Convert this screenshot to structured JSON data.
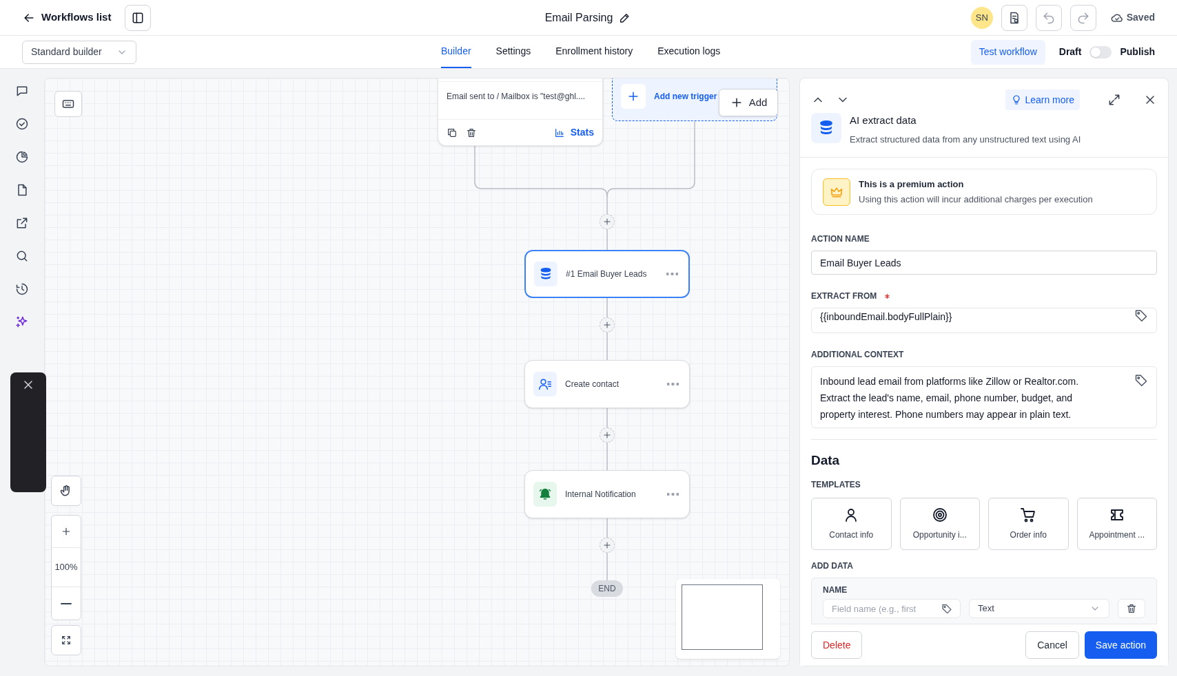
{
  "header": {
    "back_label": "Workflows list",
    "title": "Email Parsing",
    "avatar": "SN",
    "save_status": "Saved"
  },
  "toolbar": {
    "builder_select": "Standard builder",
    "tabs": [
      {
        "label": "Builder",
        "selected": true
      },
      {
        "label": "Settings",
        "selected": false
      },
      {
        "label": "Enrollment history",
        "selected": false
      },
      {
        "label": "Execution logs",
        "selected": false
      }
    ],
    "test_button": "Test workflow",
    "draft_label": "Draft",
    "publish_on": false,
    "publish_label": "Publish"
  },
  "rail": {
    "items": [
      {
        "kind": "chat",
        "selected": false
      },
      {
        "kind": "check",
        "selected": false
      },
      {
        "kind": "pie",
        "selected": false
      },
      {
        "kind": "file",
        "selected": false
      },
      {
        "kind": "external",
        "selected": false
      },
      {
        "kind": "search",
        "selected": false
      },
      {
        "kind": "history",
        "selected": false
      },
      {
        "kind": "sparkle",
        "selected": true
      }
    ]
  },
  "canvas": {
    "trigger": {
      "text": "Email sent to / Mailbox is \"test@ghl....",
      "stats_label": "Stats"
    },
    "add_trigger_label": "Add new trigger",
    "add_button": "Add",
    "nodes": [
      {
        "label": "#1 Email Buyer Leads",
        "kind": "database",
        "selected": true
      },
      {
        "label": "Create contact",
        "kind": "contact",
        "selected": false
      },
      {
        "label": "Internal Notification",
        "kind": "bell",
        "selected": false
      }
    ],
    "end_label": "END",
    "zoom_level": "100%"
  },
  "panel": {
    "title": "AI extract data",
    "subtitle": "Extract structured data from any unstructured text using AI",
    "learn_more": "Learn more",
    "premium": {
      "title": "This is a premium action",
      "description": "Using this action will incur additional charges per execution"
    },
    "fields": [
      {
        "kind": "text",
        "label": "ACTION NAME",
        "required": false,
        "value": "Email Buyer Leads"
      },
      {
        "kind": "variable",
        "label": "EXTRACT FROM",
        "required": true,
        "value": "{{inboundEmail.bodyFullPlain}}"
      },
      {
        "kind": "textarea",
        "label": "ADDITIONAL CONTEXT",
        "required": false,
        "value": "Inbound lead email from platforms like Zillow or Realtor.com. Extract the lead's name, email, phone number, budget, and property interest. Phone numbers may appear in plain text."
      }
    ],
    "data_heading": "Data",
    "templates_label": "TEMPLATES",
    "templates": [
      {
        "kind": "person",
        "label": "Contact info"
      },
      {
        "kind": "target",
        "label": "Opportunity i..."
      },
      {
        "kind": "cart",
        "label": "Order info"
      },
      {
        "kind": "ticket",
        "label": "Appointment ..."
      }
    ],
    "add_data_label": "ADD DATA",
    "name_label": "NAME",
    "name_placeholder": "Field name (e.g., first",
    "type_value": "Text",
    "delete_button": "Delete",
    "cancel_button": "Cancel",
    "save_button": "Save action"
  }
}
